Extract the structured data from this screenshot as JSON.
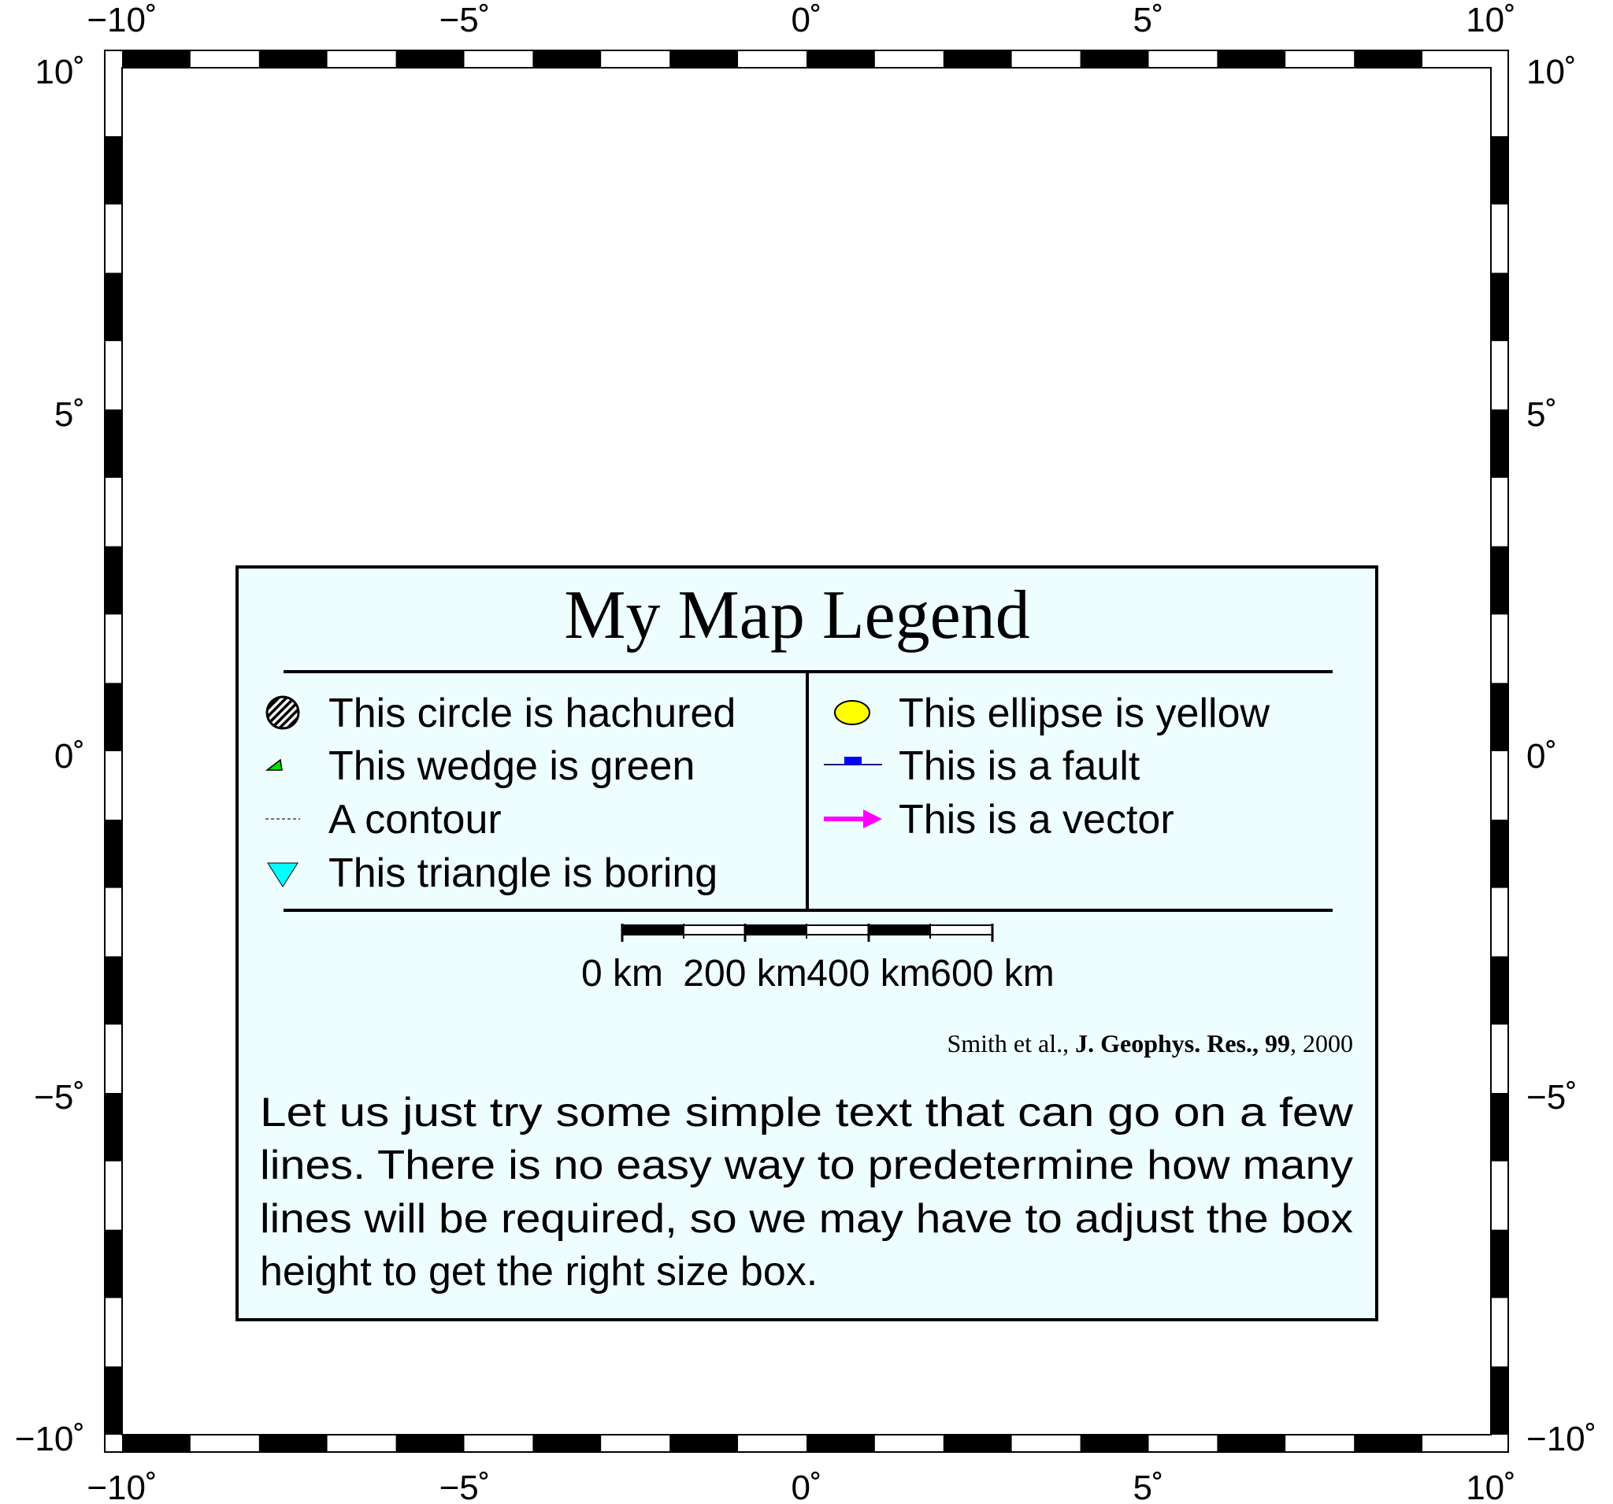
{
  "frame": {
    "x_tick_labels": [
      "−10˚",
      "−5˚",
      "0˚",
      "5˚",
      "10˚"
    ],
    "y_tick_labels": [
      "10˚",
      "5˚",
      "0˚",
      "−5˚",
      "−10˚"
    ],
    "x_range_deg": [
      -10,
      10
    ],
    "y_range_deg": [
      -10,
      10
    ],
    "frame_style": "alternating black and white checkerboard",
    "frame_colors": [
      "#000000",
      "#ffffff"
    ]
  },
  "legend": {
    "title": "My Map Legend",
    "background_color": "#eefdfd",
    "left_column": [
      {
        "icon": "hachured-circle-icon",
        "label": "This circle is hachured"
      },
      {
        "icon": "green-wedge-icon",
        "label": "This wedge is green",
        "color": "#00dd00"
      },
      {
        "icon": "contour-line-icon",
        "label": "A contour"
      },
      {
        "icon": "cyan-triangle-icon",
        "label": "This triangle is boring",
        "color": "#00ffff"
      }
    ],
    "right_column": [
      {
        "icon": "yellow-ellipse-icon",
        "label": "This ellipse is yellow",
        "color": "#ffff00"
      },
      {
        "icon": "fault-line-icon",
        "label": "This is a fault",
        "color": "#0000ff"
      },
      {
        "icon": "magenta-vector-icon",
        "label": "This is a vector",
        "color": "#ff00ff"
      }
    ],
    "scale_bar": {
      "labels": [
        "0 km",
        "200 km",
        "400 km",
        "600 km"
      ]
    },
    "citation": {
      "authors": "Smith et al., ",
      "journal": "J. Geophys. Res., 99",
      "year": ", 2000"
    },
    "paragraph_lines": [
      "Let us just try some simple text that can go on a few",
      "lines.  There is no easy way to predetermine how many",
      "lines will be required, so we may have to adjust the box",
      "height to get the right size box."
    ]
  }
}
